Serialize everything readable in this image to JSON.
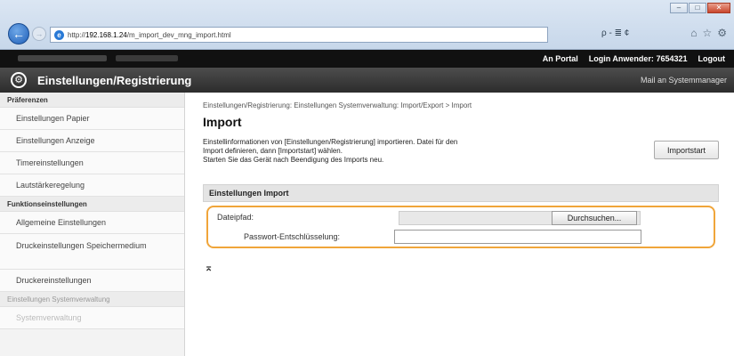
{
  "browser": {
    "back_glyph": "←",
    "forward_glyph": "→",
    "url_prefix": "http://",
    "url_host": "192.168.1.24",
    "url_path": "/m_import_dev_mng_import.html",
    "address_tools": "ρ - ≣ ¢",
    "window_buttons": [
      "–",
      "□",
      "✕"
    ],
    "toolbar_icons": [
      "⌂",
      "☆",
      "⚙"
    ]
  },
  "topbar": {
    "portal": "An Portal",
    "login_label": "Login Anwender:",
    "user": "7654321",
    "logout": "Logout"
  },
  "header": {
    "title": "Einstellungen/Registrierung",
    "mail": "Mail an Systemmanager"
  },
  "sidebar": {
    "groups": [
      {
        "title": "Präferenzen",
        "items": [
          "Einstellungen Papier",
          "Einstellungen Anzeige",
          "Timereinstellungen",
          "Lautstärkeregelung"
        ]
      },
      {
        "title": "Funktionseinstellungen",
        "items": [
          "Allgemeine Einstellungen",
          "Druckeinstellungen Speichermedium",
          "Druckereinstellungen"
        ]
      },
      {
        "title": "Einstellungen Systemverwaltung",
        "items": [
          "Systemverwaltung"
        ]
      }
    ]
  },
  "main": {
    "breadcrumb": "Einstellungen/Registrierung: Einstellungen Systemverwaltung: Import/Export > Import",
    "title": "Import",
    "description_lines": [
      "Einstellinformationen von [Einstellungen/Registrierung] importieren. Datei für den",
      "Import definieren, dann [Importstart] wählen.",
      "Starten Sie das Gerät nach Beendigung des Imports neu."
    ],
    "import_button": "Importstart",
    "section_title": "Einstellungen Import",
    "file_path_label": "Dateipfad:",
    "browse_button": "Durchsuchen...",
    "password_label": "Passwort-Entschlüsselung:",
    "password_value": "",
    "top_link": "⌅"
  }
}
